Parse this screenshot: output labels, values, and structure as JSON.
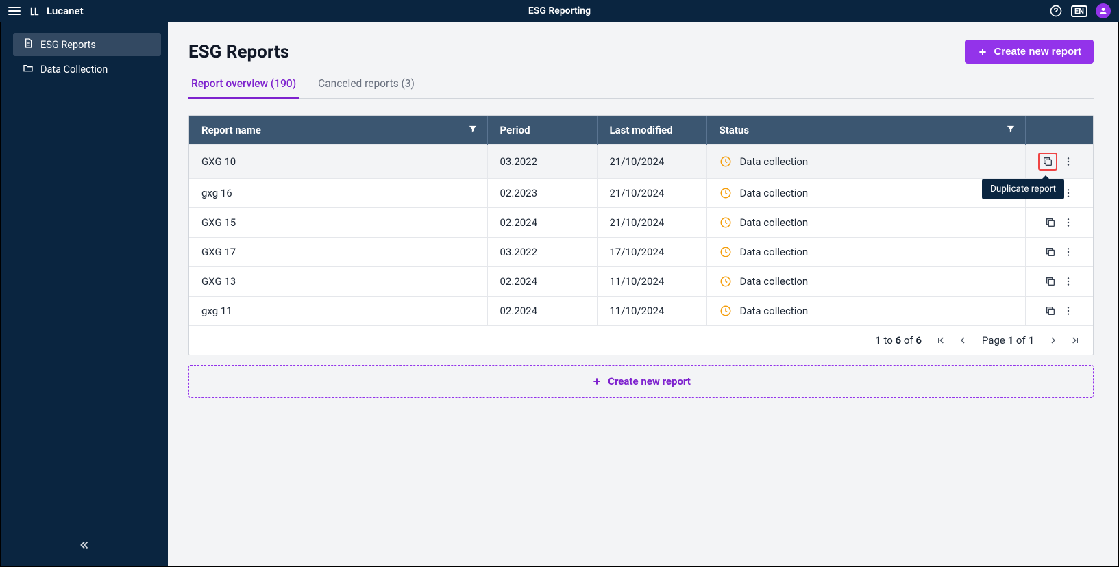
{
  "app": {
    "brand": "Lucanet",
    "title": "ESG Reporting",
    "language": "EN"
  },
  "sidebar": {
    "items": [
      {
        "label": "ESG Reports",
        "active": true
      },
      {
        "label": "Data Collection",
        "active": false
      }
    ]
  },
  "page": {
    "title": "ESG Reports",
    "create_button": "Create new report"
  },
  "tabs": [
    {
      "label": "Report overview (190)",
      "active": true
    },
    {
      "label": "Canceled reports (3)",
      "active": false
    }
  ],
  "table": {
    "columns": {
      "name": "Report name",
      "period": "Period",
      "modified": "Last modified",
      "status": "Status"
    },
    "rows": [
      {
        "name": "GXG 10",
        "period": "03.2022",
        "modified": "21/10/2024",
        "status": "Data collection",
        "hovered": true,
        "highlight_duplicate": true
      },
      {
        "name": "gxg 16",
        "period": "02.2023",
        "modified": "21/10/2024",
        "status": "Data collection"
      },
      {
        "name": "GXG 15",
        "period": "02.2024",
        "modified": "21/10/2024",
        "status": "Data collection"
      },
      {
        "name": "GXG 17",
        "period": "03.2022",
        "modified": "17/10/2024",
        "status": "Data collection"
      },
      {
        "name": "GXG 13",
        "period": "02.2024",
        "modified": "11/10/2024",
        "status": "Data collection"
      },
      {
        "name": "gxg 11",
        "period": "02.2024",
        "modified": "11/10/2024",
        "status": "Data collection"
      }
    ]
  },
  "tooltip": {
    "duplicate": "Duplicate report"
  },
  "pagination": {
    "range_from": "1",
    "range_to": "6",
    "range_total": "6",
    "to_word": " to ",
    "of_word": " of ",
    "page_word": "Page ",
    "page_current": "1",
    "page_total": "1"
  },
  "footer": {
    "create_label": "Create new report"
  }
}
